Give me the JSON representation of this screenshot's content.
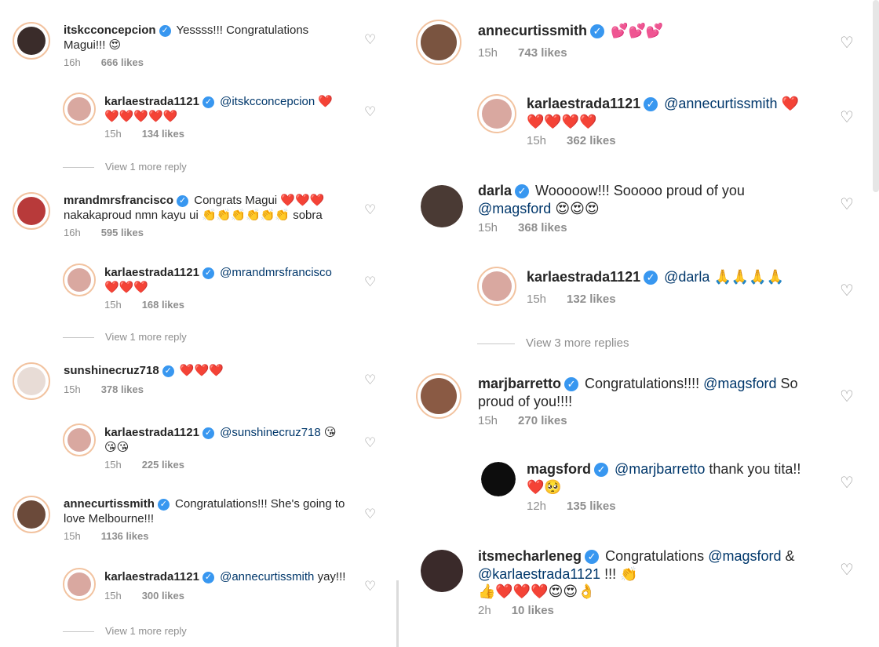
{
  "verified_mark": "✓",
  "heart_icon": "♡",
  "left": {
    "c1": {
      "user": "itskcconcepcion",
      "text": "Yessss!!! Congratulations",
      "text2": "Magui!!! 😍",
      "time": "16h",
      "likes": "666 likes"
    },
    "r1": {
      "user": "karlaestrada1121",
      "mention": "@itskcconcepcion",
      "emoji1": "❤️",
      "line2": "❤️❤️❤️❤️❤️",
      "time": "15h",
      "likes": "134 likes"
    },
    "more1": "View 1 more reply",
    "c2": {
      "user": "mrandmrsfrancisco",
      "text": "Congrats Magui",
      "emoji1": "❤️❤️❤️",
      "text2": "nakakaproud nmn kayu ui",
      "emoji2": "👏👏👏👏👏👏",
      "text3": "sobra",
      "time": "16h",
      "likes": "595 likes"
    },
    "r2": {
      "user": "karlaestrada1121",
      "mention": "@mrandmrsfrancisco",
      "line2": "❤️❤️❤️",
      "time": "15h",
      "likes": "168 likes"
    },
    "more2": "View 1 more reply",
    "c3": {
      "user": "sunshinecruz718",
      "emoji1": "❤️❤️❤️",
      "time": "15h",
      "likes": "378 likes"
    },
    "r3": {
      "user": "karlaestrada1121",
      "mention": "@sunshinecruz718",
      "emoji1": "😘",
      "line2": "😘😘",
      "time": "15h",
      "likes": "225 likes"
    },
    "c4": {
      "user": "annecurtissmith",
      "text": "Congratulations!!! She's going to",
      "text2": "love Melbourne!!!",
      "time": "15h",
      "likes": "1136 likes"
    },
    "r4": {
      "user": "karlaestrada1121",
      "mention": "@annecurtissmith",
      "text": "yay!!!",
      "time": "15h",
      "likes": "300 likes"
    },
    "more4": "View 1 more reply"
  },
  "right": {
    "c1": {
      "user": "annecurtissmith",
      "emoji1": "💕💕💕",
      "time": "15h",
      "likes": "743 likes"
    },
    "r1": {
      "user": "karlaestrada1121",
      "mention": "@annecurtissmith",
      "emoji1": "❤️",
      "line2": "❤️❤️❤️❤️",
      "time": "15h",
      "likes": "362 likes"
    },
    "c2": {
      "user": "darla",
      "text": "Wooooow!!! Sooooo proud of you",
      "mention": "@magsford",
      "emoji1": "😍😍😍",
      "time": "15h",
      "likes": "368 likes"
    },
    "r2": {
      "user": "karlaestrada1121",
      "mention": "@darla",
      "emoji1": "🙏🙏🙏🙏",
      "time": "15h",
      "likes": "132 likes"
    },
    "more2": "View 3 more replies",
    "c3": {
      "user": "marjbarretto",
      "text": "Congratulations!!!!",
      "mention": "@magsford",
      "text2": "So",
      "text3": "proud of you!!!!",
      "time": "15h",
      "likes": "270 likes"
    },
    "r3": {
      "user": "magsford",
      "mention": "@marjbarretto",
      "text": "thank you tita!!",
      "line2": "❤️🥺",
      "time": "12h",
      "likes": "135 likes"
    },
    "c4": {
      "user": "itsmecharleneg",
      "text": "Congratulations",
      "mention": "@magsford",
      "text2": "&",
      "mention2": "@karlaestrada1121",
      "text3": "!!!",
      "emoji1": "👏",
      "line2": "👍❤️❤️❤️😍😍👌",
      "time": "2h",
      "likes": "10 likes"
    }
  }
}
